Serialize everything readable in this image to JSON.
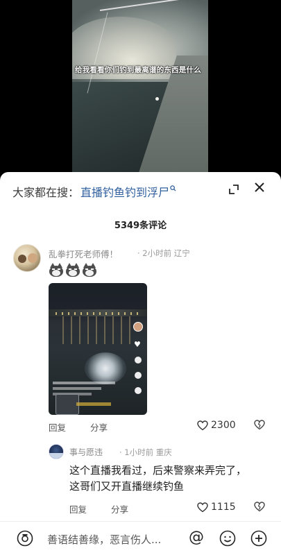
{
  "video": {
    "caption": "给我看看你们钓到最离谱的东西是什么"
  },
  "sheet": {
    "search_prefix": "大家都在搜：",
    "search_term": "直播钓鱼钓到浮尸",
    "comment_count": "5349条评论"
  },
  "comments": [
    {
      "username": "乱拳打死老师傅！",
      "meta": "· 2小时前 辽宁",
      "reply_label": "回复",
      "share_label": "分享",
      "likes": "2300"
    }
  ],
  "reply": {
    "username": "事与愿违",
    "meta": "· 1小时前 重庆",
    "text": "这个直播我看过，后来警察来弄完了，这哥们又开直播继续钓鱼",
    "reply_label": "回复",
    "share_label": "分享",
    "likes": "1115"
  },
  "input": {
    "placeholder": "善语结善缘，恶言伤人..."
  },
  "colors": {
    "link": "#2f5f9e",
    "muted": "#8a8a8a"
  }
}
